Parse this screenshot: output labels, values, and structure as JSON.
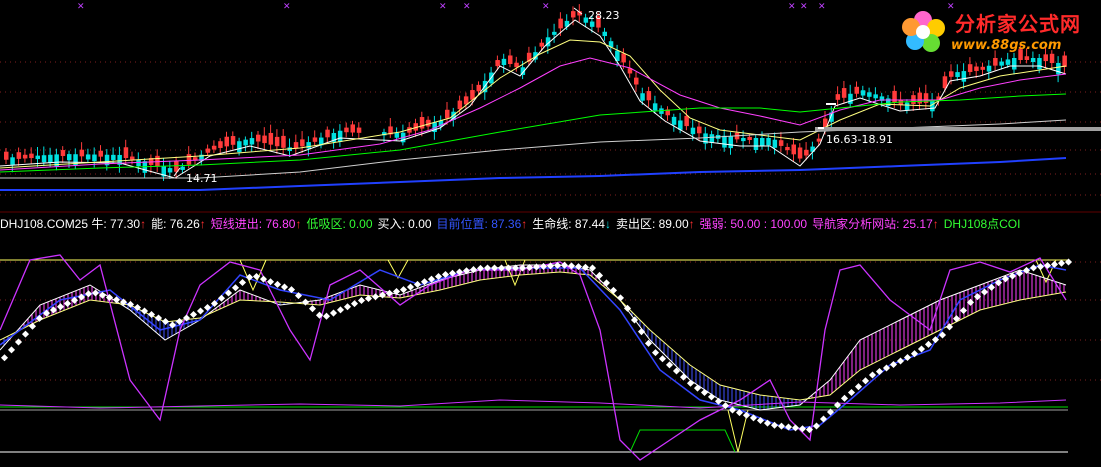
{
  "logo": {
    "name": "分析家公式网",
    "url": "www.88gs.com"
  },
  "price_labels": {
    "high": "28.23",
    "low": "14.71",
    "range": "16.63-18.91"
  },
  "indicator_bar": {
    "items": [
      {
        "text": "DHJ108.COM25  牛: 77.30",
        "color": "#ffffff",
        "arrow": "↑",
        "arrow_color": "#ff3030"
      },
      {
        "text": "能: 76.26",
        "color": "#ffffff",
        "arrow": "↑",
        "arrow_color": "#ff3030"
      },
      {
        "text": "短线进出: 76.80",
        "color": "#ff44ff",
        "arrow": "↑",
        "arrow_color": "#ff3030"
      },
      {
        "text": "低吸区: 0.00",
        "color": "#33ff33",
        "arrow": "",
        "arrow_color": ""
      },
      {
        "text": "买入: 0.00",
        "color": "#ffffff",
        "arrow": "",
        "arrow_color": ""
      },
      {
        "text": "目前位置: 87.36",
        "color": "#3355ff",
        "arrow": "↑",
        "arrow_color": "#ff3030"
      },
      {
        "text": "生命线: 87.44",
        "color": "#ffffff",
        "arrow": "↓",
        "arrow_color": "#00dddd"
      },
      {
        "text": "卖出区: 89.00",
        "color": "#ffffff",
        "arrow": "↑",
        "arrow_color": "#ff3030"
      },
      {
        "text": "强弱: 50.00  : 100.00",
        "color": "#ff44ff",
        "arrow": "",
        "arrow_color": ""
      },
      {
        "text": "导航家分析网站: 25.17",
        "color": "#ff44ff",
        "arrow": "↑",
        "arrow_color": "#ff3030"
      },
      {
        "text": "DHJ108点COI",
        "color": "#33ff33",
        "arrow": "",
        "arrow_color": ""
      }
    ]
  },
  "colors": {
    "up": "#ff3b3b",
    "down": "#00e0e0",
    "ma5": "#ffffff",
    "ma10": "#ffff80",
    "ma20": "#ff40ff",
    "ma60": "#00ff00",
    "ma120": "#d0d0d0",
    "ma250": "#2040ff",
    "grid": "#802020",
    "zone": "#ffff60"
  }
}
